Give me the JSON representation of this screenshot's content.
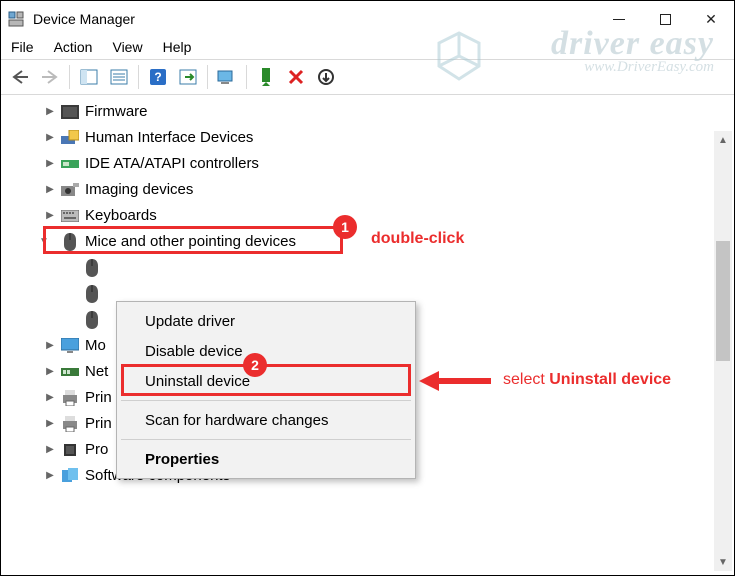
{
  "window": {
    "title": "Device Manager"
  },
  "menu": {
    "file": "File",
    "action": "Action",
    "view": "View",
    "help": "Help"
  },
  "tree": {
    "firmware": "Firmware",
    "hid": "Human Interface Devices",
    "ide": "IDE ATA/ATAPI controllers",
    "imaging": "Imaging devices",
    "keyboards": "Keyboards",
    "mice": "Mice and other pointing devices",
    "monitors": "Mo",
    "network": "Net",
    "printq": "Prin",
    "printers": "Prin",
    "processors": "Pro",
    "software": "Software components"
  },
  "context_menu": {
    "update": "Update driver",
    "disable": "Disable device",
    "uninstall": "Uninstall device",
    "scan": "Scan for hardware changes",
    "properties": "Properties"
  },
  "annotations": {
    "step1": "1",
    "step1_text": "double-click",
    "step2": "2",
    "step2_text_a": "select ",
    "step2_text_b": "Uninstall device"
  },
  "watermark": {
    "line1": "driver easy",
    "line2": "www.DriverEasy.com"
  }
}
